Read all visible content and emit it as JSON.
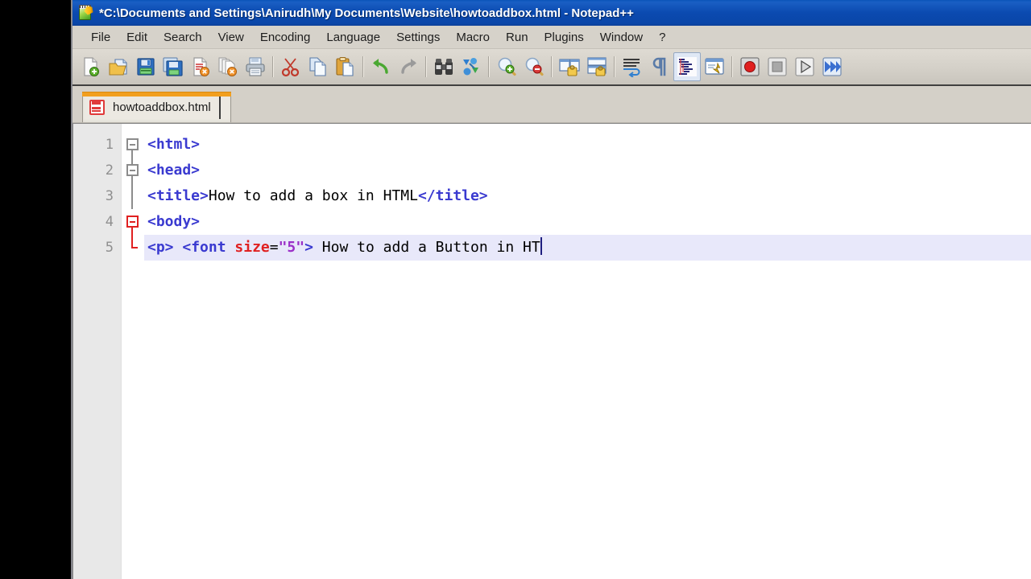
{
  "window": {
    "title": "*C:\\Documents and Settings\\Anirudh\\My Documents\\Website\\howtoaddbox.html - Notepad++",
    "app_icon": "notepad-plus-plus-icon"
  },
  "menubar": {
    "items": [
      {
        "label": "File"
      },
      {
        "label": "Edit"
      },
      {
        "label": "Search"
      },
      {
        "label": "View"
      },
      {
        "label": "Encoding"
      },
      {
        "label": "Language"
      },
      {
        "label": "Settings"
      },
      {
        "label": "Macro"
      },
      {
        "label": "Run"
      },
      {
        "label": "Plugins"
      },
      {
        "label": "Window"
      },
      {
        "label": "?"
      }
    ]
  },
  "toolbar": {
    "groups": [
      {
        "buttons": [
          {
            "icon": "new-file-icon",
            "label": "New",
            "active": false
          },
          {
            "icon": "open-folder-icon",
            "label": "Open",
            "active": false
          },
          {
            "icon": "save-icon",
            "label": "Save",
            "active": false
          },
          {
            "icon": "save-all-icon",
            "label": "Save All",
            "active": false
          },
          {
            "icon": "close-file-icon",
            "label": "Close",
            "active": false
          },
          {
            "icon": "close-all-icon",
            "label": "Close All",
            "active": false
          },
          {
            "icon": "print-icon",
            "label": "Print",
            "active": false
          }
        ]
      },
      {
        "buttons": [
          {
            "icon": "cut-scissors-icon",
            "label": "Cut",
            "active": false
          },
          {
            "icon": "copy-icon",
            "label": "Copy",
            "active": false
          },
          {
            "icon": "paste-icon",
            "label": "Paste",
            "active": false
          }
        ]
      },
      {
        "buttons": [
          {
            "icon": "undo-arrow-icon",
            "label": "Undo",
            "active": false
          },
          {
            "icon": "redo-arrow-icon",
            "label": "Redo",
            "active": false
          }
        ]
      },
      {
        "buttons": [
          {
            "icon": "find-binoculars-icon",
            "label": "Find",
            "active": false
          },
          {
            "icon": "replace-icon",
            "label": "Replace",
            "active": false
          }
        ]
      },
      {
        "buttons": [
          {
            "icon": "zoom-in-icon",
            "label": "Zoom In",
            "active": false
          },
          {
            "icon": "zoom-out-icon",
            "label": "Zoom Out",
            "active": false
          }
        ]
      },
      {
        "buttons": [
          {
            "icon": "sync-vertical-scroll-icon",
            "label": "Sync Vertical Scrolling",
            "active": false
          },
          {
            "icon": "sync-horizontal-scroll-icon",
            "label": "Sync Horizontal Scrolling",
            "active": false
          }
        ]
      },
      {
        "buttons": [
          {
            "icon": "word-wrap-icon",
            "label": "Word Wrap",
            "active": false
          },
          {
            "icon": "show-all-chars-icon",
            "label": "Show All Characters",
            "active": false
          },
          {
            "icon": "indent-guide-icon",
            "label": "Show Indent Guide",
            "active": true
          },
          {
            "icon": "user-defined-dialog-icon",
            "label": "User Defined Dialogue",
            "active": false
          }
        ]
      },
      {
        "buttons": [
          {
            "icon": "macro-record-icon",
            "label": "Start Recording",
            "active": false
          },
          {
            "icon": "macro-stop-icon",
            "label": "Stop Recording",
            "active": false
          },
          {
            "icon": "macro-play-icon",
            "label": "Play Macro",
            "active": false
          },
          {
            "icon": "macro-play-multiple-icon",
            "label": "Run Macro Multiple Times",
            "active": false
          }
        ]
      }
    ]
  },
  "tabs": [
    {
      "label": "howtoaddbox.html",
      "icon": "unsaved-file-icon",
      "active": true,
      "modified": true
    }
  ],
  "editor": {
    "language": "HTML",
    "current_line": 5,
    "cursor_visible": true,
    "lines": [
      {
        "number": "1",
        "fold": "open",
        "fold_color": "gray",
        "tokens": [
          {
            "text": "<html>",
            "type": "tag"
          }
        ]
      },
      {
        "number": "2",
        "fold": "open",
        "fold_color": "gray",
        "tokens": [
          {
            "text": "<head>",
            "type": "tag"
          }
        ]
      },
      {
        "number": "3",
        "fold": "none",
        "fold_color": "gray",
        "tokens": [
          {
            "text": "<title>",
            "type": "tag"
          },
          {
            "text": "How to add a box in HTML",
            "type": "text"
          },
          {
            "text": "</title>",
            "type": "tag"
          }
        ]
      },
      {
        "number": "4",
        "fold": "open",
        "fold_color": "red",
        "tokens": [
          {
            "text": "<body>",
            "type": "tag"
          }
        ]
      },
      {
        "number": "5",
        "fold": "tail",
        "fold_color": "red",
        "current": true,
        "tokens": [
          {
            "text": "<p>",
            "type": "tag"
          },
          {
            "text": " ",
            "type": "text"
          },
          {
            "text": "<font",
            "type": "tag"
          },
          {
            "text": " ",
            "type": "text"
          },
          {
            "text": "size",
            "type": "attr"
          },
          {
            "text": "=",
            "type": "eq"
          },
          {
            "text": "\"5\"",
            "type": "val"
          },
          {
            "text": ">",
            "type": "tag"
          },
          {
            "text": " How to add a Button in HT",
            "type": "text"
          }
        ]
      }
    ]
  },
  "colors": {
    "titlebar": "#0b4ab0",
    "chrome": "#d4d0c8",
    "tab_active_accent": "#f29f1e",
    "editor_bg": "#ffffff",
    "current_line_highlight": "#e8e8fa",
    "tag": "#3a3ad0",
    "attribute": "#e02020",
    "attribute_value": "#9b30c8",
    "plain_text": "#000000",
    "line_number": "#8f8f8f",
    "fold_active": "#e02020"
  }
}
